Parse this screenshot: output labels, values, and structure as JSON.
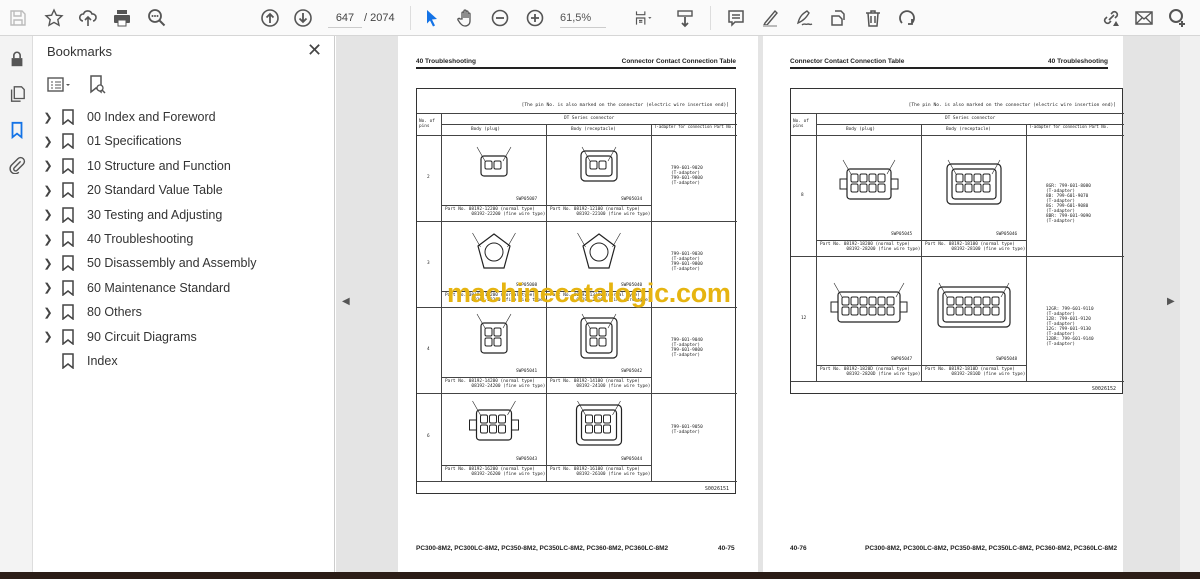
{
  "toolbar": {
    "icons": [
      "save-icon",
      "bookmark-star-icon",
      "upload-cloud-icon",
      "print-icon",
      "search-zoom-icon",
      "page-up-icon",
      "page-down-icon",
      "select-arrow-icon",
      "hand-icon",
      "zoom-out-icon",
      "zoom-in-icon",
      "page-fit-icon",
      "scroll-mode-icon",
      "comment-icon",
      "highlight-icon",
      "sign-icon",
      "extract-icon",
      "delete-icon",
      "rotate-icon",
      "share-link-icon",
      "email-icon",
      "add-user-icon"
    ],
    "current_page": "647",
    "total_pages": "/ 2074",
    "zoom": "61,5%",
    "accent": "#1473e6"
  },
  "panel": {
    "title": "Bookmarks",
    "bookmarks": [
      {
        "label": "00 Index and Foreword",
        "expandable": true
      },
      {
        "label": "01 Specifications",
        "expandable": true
      },
      {
        "label": "10 Structure and Function",
        "expandable": true
      },
      {
        "label": "20 Standard Value Table",
        "expandable": true
      },
      {
        "label": "30 Testing and Adjusting",
        "expandable": true
      },
      {
        "label": "40 Troubleshooting",
        "expandable": true
      },
      {
        "label": "50 Disassembly and Assembly",
        "expandable": true
      },
      {
        "label": "60 Maintenance Standard",
        "expandable": true
      },
      {
        "label": "80 Others",
        "expandable": true
      },
      {
        "label": "90 Circuit Diagrams",
        "expandable": true
      },
      {
        "label": "Index",
        "expandable": false
      }
    ]
  },
  "pages": {
    "left": {
      "header_left": "40 Troubleshooting",
      "header_right": "Connector Contact Connection Table",
      "footer_models": "PC300-8M2, PC300LC-8M2, PC350-8M2, PC350LC-8M2, PC360-8M2, PC360LC-8M2",
      "footer_page": "40-75",
      "table": {
        "note": "[The pin No. is also marked on the connector (electric wire insertion end)]",
        "pins_header": "No. of pins",
        "series": "DT Series connector",
        "col_plug": "Body (plug)",
        "col_recep": "Body (receptacle)",
        "col_tool": "T-adapter for connection Part No.",
        "rows": [
          {
            "pins": "2",
            "plug_code": "SWP05007",
            "recep_code": "SWP05034",
            "plug_part": "Part No. 08192-12200 (normal type)\n          08192-22200 (fine wire type)",
            "recep_part": "Part No. 08192-12100 (normal type)\n          08192-22100 (fine wire type)",
            "tool": "799-601-9020\n(T-adapter)\n799-601-9800\n(T-adapter)"
          },
          {
            "pins": "3",
            "plug_code": "SWP05008",
            "recep_code": "SWP05040",
            "plug_part": "Part No. 08192-13200 (normal type)\n          08192-23200 (fine wire type)",
            "recep_part": "Part No. 08192-13100 (normal type)\n          08192-23100 (fine wire type)",
            "tool": "799-601-9030\n(T-adapter)\n799-601-9800\n(T-adapter)"
          },
          {
            "pins": "4",
            "plug_code": "SWP05041",
            "recep_code": "SWP05042",
            "plug_part": "Part No. 08192-14200 (normal type)\n          08192-24200 (fine wire type)",
            "recep_part": "Part No. 08192-14100 (normal type)\n          08192-24100 (fine wire type)",
            "tool": "799-601-9040\n(T-adapter)\n799-601-9800\n(T-adapter)"
          },
          {
            "pins": "6",
            "plug_code": "SWP05043",
            "recep_code": "SWP05044",
            "plug_part": "Part No. 08192-16200 (normal type)\n          08192-26200 (fine wire type)",
            "recep_part": "Part No. 08192-16100 (normal type)\n          08192-26100 (fine wire type)",
            "tool": "799-601-9050\n(T-adapter)"
          }
        ],
        "code": "S0026151"
      }
    },
    "right": {
      "header_left": "Connector Contact Connection Table",
      "header_right": "40 Troubleshooting",
      "footer_page": "40-76",
      "footer_models": "PC300-8M2, PC300LC-8M2, PC350-8M2, PC350LC-8M2, PC360-8M2, PC360LC-8M2",
      "table": {
        "note": "[The pin No. is also marked on the connector (electric wire insertion end)]",
        "pins_header": "No. of pins",
        "series": "DT Series connector",
        "col_plug": "Body (plug)",
        "col_recep": "Body (receptacle)",
        "col_tool": "T-adapter for connection Part No.",
        "rows": [
          {
            "pins": "8",
            "plug_code": "SWP05045",
            "recep_code": "SWP05046",
            "plug_part": "Part No. 08192-18200 (normal type)\n          08192-28200 (fine wire type)",
            "recep_part": "Part No. 08192-18100 (normal type)\n          08192-28100 (fine wire type)",
            "tool": "8GR: 799-601-8080\n(T-adapter)\n8B: 799-601-9070\n(T-adapter)\n8G: 799-601-9080\n(T-adapter)\n8BR: 799-601-9090\n(T-adapter)"
          },
          {
            "pins": "12",
            "plug_code": "SWP05047",
            "recep_code": "SWP05048",
            "plug_part": "Part No. 08192-1820D (normal type)\n          08192-2820D (fine wire type)",
            "recep_part": "Part No. 08192-1810D (normal type)\n          08192-2810D (fine wire type)",
            "tool": "12GR: 799-601-9110\n(T-adapter)\n12B: 799-601-9120\n(T-adapter)\n12G: 799-601-9130\n(T-adapter)\n12BR: 799-601-9140\n(T-adapter)"
          }
        ],
        "code": "S0026152"
      }
    }
  },
  "watermark": "machinecatalogic.com"
}
